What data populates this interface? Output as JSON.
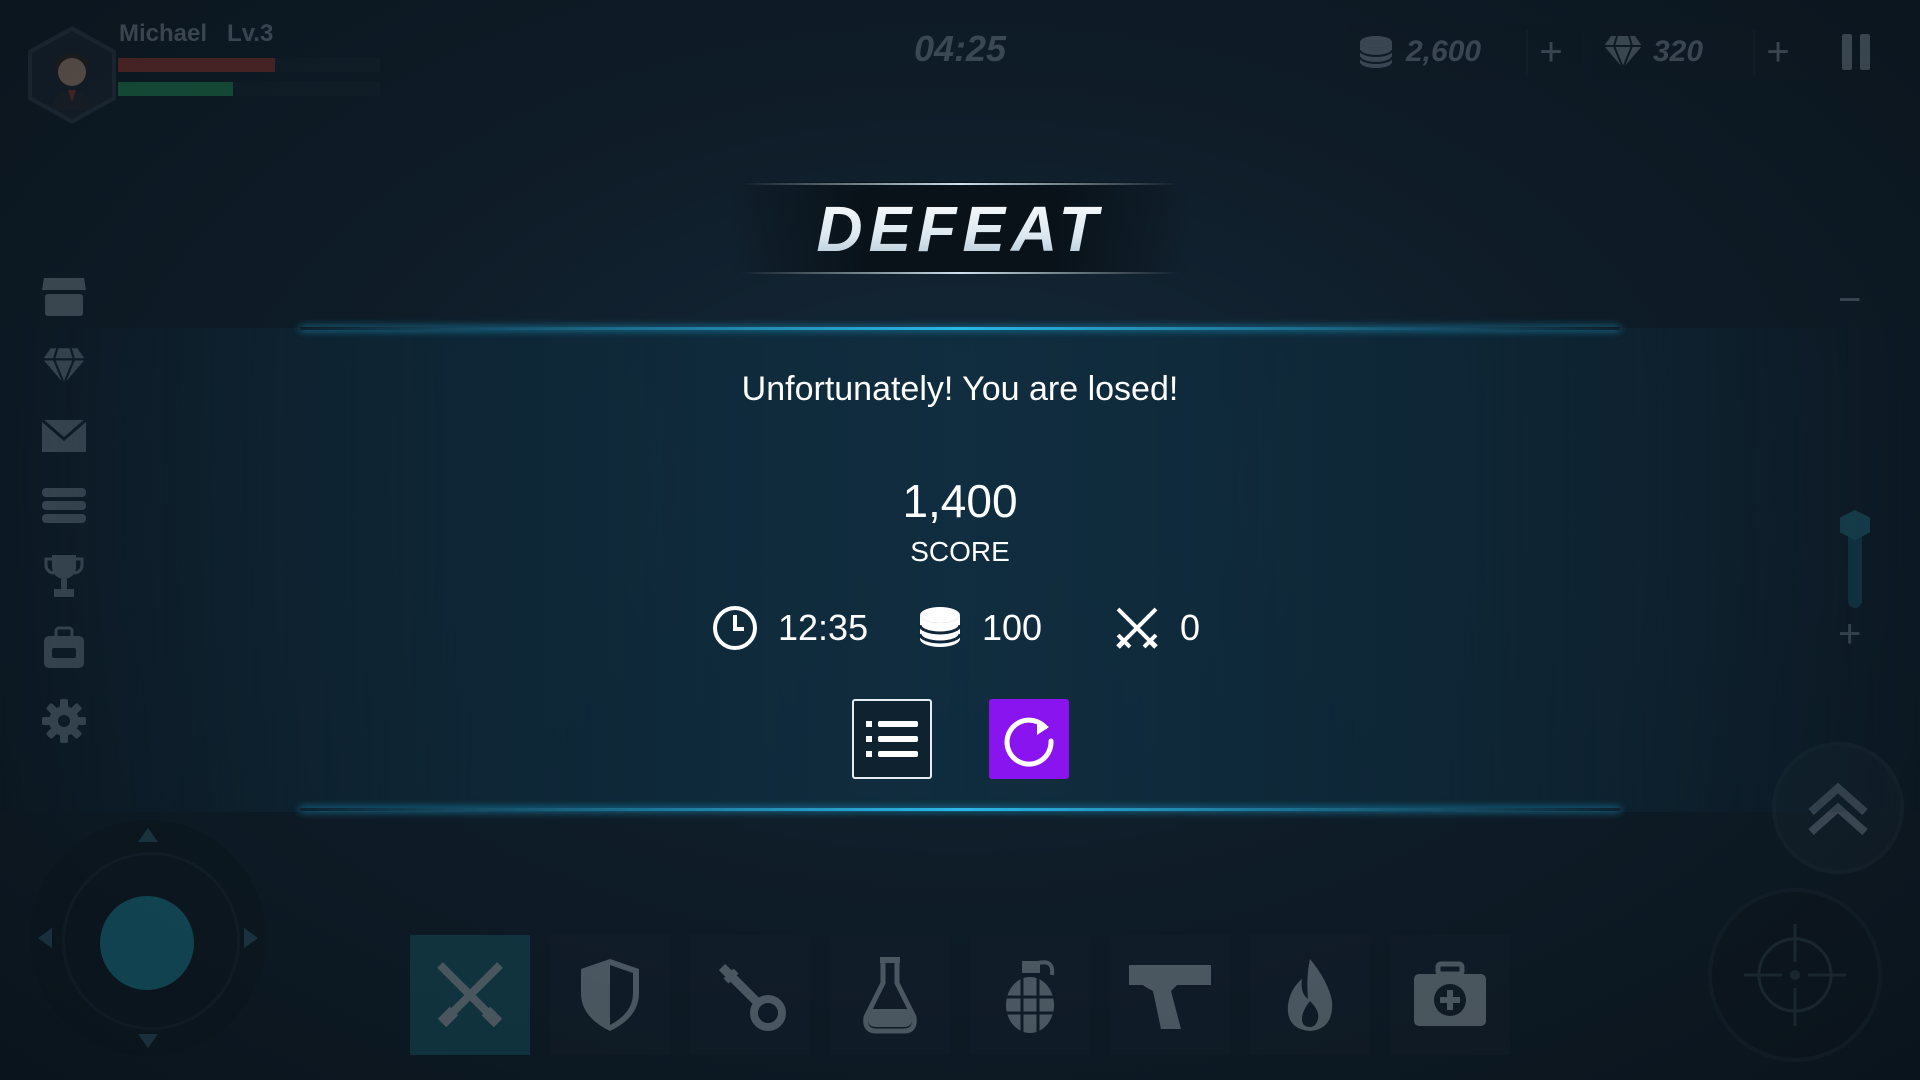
{
  "player": {
    "name": "Michael",
    "level": "Lv.3",
    "hp_fraction": 0.6,
    "xp_fraction": 0.44
  },
  "top_bar": {
    "timer": "04:25",
    "coins": "2,600",
    "gems": "320",
    "plus": "+"
  },
  "zoom": {
    "minus": "−",
    "plus": "+",
    "level_fraction": 0.3
  },
  "sidebar": {
    "items": [
      "shop-icon",
      "gem-icon",
      "mail-icon",
      "list-icon",
      "trophy-icon",
      "backpack-icon",
      "gear-icon"
    ]
  },
  "inventory": {
    "slots": [
      "swords-icon",
      "shield-icon",
      "key-icon",
      "potion-icon",
      "grenade-icon",
      "pistol-icon",
      "fire-icon",
      "medkit-icon"
    ],
    "selected_index": 0
  },
  "result": {
    "title": "DEFEAT",
    "message": "Unfortunately! You are losed!",
    "score": "1,400",
    "score_label": "SCORE",
    "time": "12:35",
    "coins": "100",
    "kills": "0"
  },
  "colors": {
    "accent": "#8a14f0",
    "glow": "#2ab8e8",
    "hp": "#c0392b",
    "xp": "#27ae60"
  }
}
